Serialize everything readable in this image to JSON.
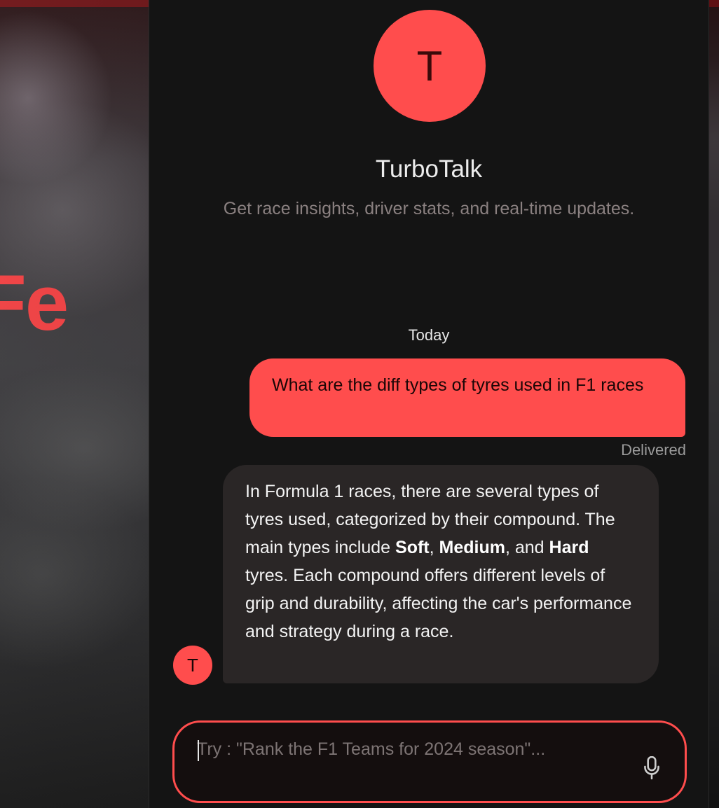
{
  "background": {
    "title_fragment": "laFe"
  },
  "chat": {
    "avatar_letter": "T",
    "bot_name": "TurboTalk",
    "tagline": "Get race insights, driver stats, and real-time updates.",
    "day_separator": "Today",
    "messages": [
      {
        "role": "user",
        "text": "What are the diff types of tyres used in F1 races",
        "status": "Delivered"
      },
      {
        "role": "bot",
        "parts": [
          "In Formula 1 races, there are several types of tyres used, categorized by their compound. The main types include ",
          "Soft",
          ", ",
          "Medium",
          ", and ",
          "Hard",
          " tyres. Each compound offers different levels of grip and durability, affecting the car's performance and strategy during a race."
        ]
      }
    ],
    "composer": {
      "placeholder": "Try : \"Rank the F1 Teams for 2024 season\"...",
      "value": "",
      "mic_icon": "microphone-icon"
    }
  },
  "colors": {
    "accent": "#ff4d4d",
    "panel_bg": "#141414",
    "bot_bubble": "#2a2626"
  }
}
